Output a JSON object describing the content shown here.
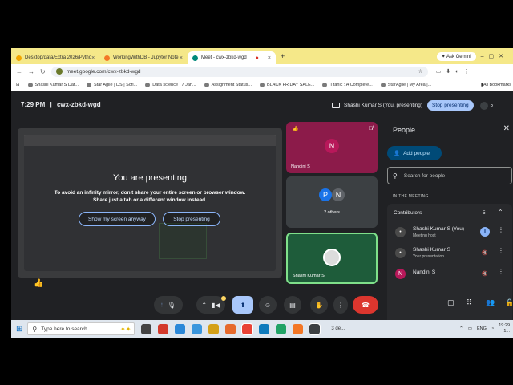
{
  "browser": {
    "tabs": [
      {
        "label": "Desktop/data/Extra 2026/Pytho",
        "color": "#f2a600"
      },
      {
        "label": "WorkingWithDB - Jupyter Note",
        "color": "#f37726"
      },
      {
        "label": "Meet - cwx-zbkd-wgd",
        "color": "#00897b",
        "active": true
      }
    ],
    "new_tab": "+",
    "gemini": "Ask Gemini",
    "url": "meet.google.com/cwx-zbkd-wgd",
    "bookmarks": [
      "Shashi Kumar S Dat...",
      "Star Agile | DS | Scri...",
      "Data science | 7 Jan...",
      "Assignment Status...",
      "BLACK FRIDAY SALE...",
      "Titanic : A Complete...",
      "StarAgile | My Area |..."
    ],
    "all_bookmarks": "All Bookmarks"
  },
  "meet": {
    "time": "7:29 PM",
    "separator": "|",
    "code": "cwx-zbkd-wgd",
    "presenting_chip": "Shashi Kumar S (You, presenting)",
    "stop_presenting": "Stop presenting",
    "participant_count": "5",
    "mirror": {
      "title": "You are presenting",
      "line1": "To avoid an infinity mirror, don't share your entire screen or browser window.",
      "line2": "Share just a tab or a different window instead.",
      "show_button": "Show my screen anyway",
      "stop_button": "Stop presenting"
    },
    "reaction": "👍",
    "tiles": [
      {
        "label": "Nandini S",
        "initial": "N",
        "bg": "#8c1b4a",
        "avatar": "#b8185a"
      },
      {
        "label": "2 others",
        "initials": [
          "P",
          "N"
        ],
        "bg": "#3c4043"
      },
      {
        "label": "Shashi Kumar S",
        "bg": "#1e5c3a"
      }
    ]
  },
  "people": {
    "title": "People",
    "add": "Add people",
    "search_placeholder": "Search for people",
    "section": "IN THE MEETING",
    "group": "Contributors",
    "group_count": "5",
    "members": [
      {
        "name": "Shashi Kumar S (You)",
        "role": "Meeting host",
        "avatar": "#4a4a4a"
      },
      {
        "name": "Shashi Kumar S",
        "role": "Your presentation",
        "avatar": "#4a4a4a"
      },
      {
        "name": "Nandini S",
        "role": "",
        "initial": "N",
        "avatar": "#b8185a"
      }
    ]
  },
  "taskbar": {
    "search_placeholder": "Type here to search",
    "weather": "3 de...",
    "lang": "ENG",
    "time": "19:29",
    "date": "1..."
  }
}
